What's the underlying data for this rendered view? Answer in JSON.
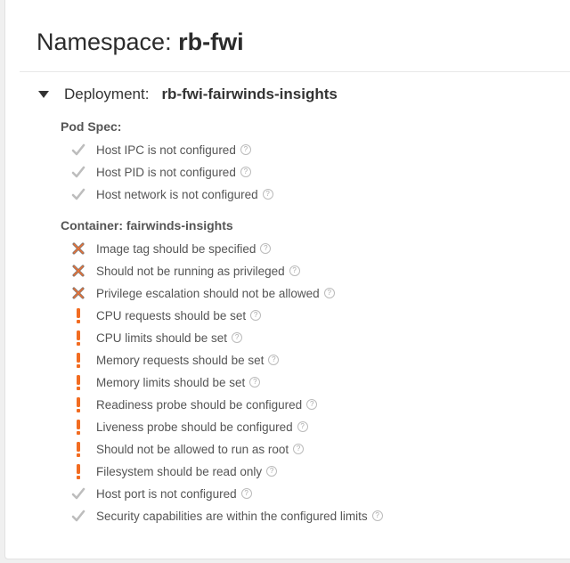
{
  "namespace": {
    "label": "Namespace:",
    "name": "rb-fwi"
  },
  "deployment": {
    "label": "Deployment:",
    "name": "rb-fwi-fairwinds-insights"
  },
  "colors": {
    "pass": "#bdbdbd",
    "danger": "#e8743b",
    "warning": "#f26c21"
  },
  "sections": [
    {
      "title": "Pod Spec:",
      "items": [
        {
          "status": "pass",
          "text": "Host IPC is not configured"
        },
        {
          "status": "pass",
          "text": "Host PID is not configured"
        },
        {
          "status": "pass",
          "text": "Host network is not configured"
        }
      ]
    },
    {
      "title": "Container: fairwinds-insights",
      "items": [
        {
          "status": "danger",
          "text": "Image tag should be specified"
        },
        {
          "status": "danger",
          "text": "Should not be running as privileged"
        },
        {
          "status": "danger",
          "text": "Privilege escalation should not be allowed"
        },
        {
          "status": "warning",
          "text": "CPU requests should be set"
        },
        {
          "status": "warning",
          "text": "CPU limits should be set"
        },
        {
          "status": "warning",
          "text": "Memory requests should be set"
        },
        {
          "status": "warning",
          "text": "Memory limits should be set"
        },
        {
          "status": "warning",
          "text": "Readiness probe should be configured"
        },
        {
          "status": "warning",
          "text": "Liveness probe should be configured"
        },
        {
          "status": "warning",
          "text": "Should not be allowed to run as root"
        },
        {
          "status": "warning",
          "text": "Filesystem should be read only"
        },
        {
          "status": "pass",
          "text": "Host port is not configured"
        },
        {
          "status": "pass",
          "text": "Security capabilities are within the configured limits"
        }
      ]
    }
  ],
  "help_glyph": "?"
}
